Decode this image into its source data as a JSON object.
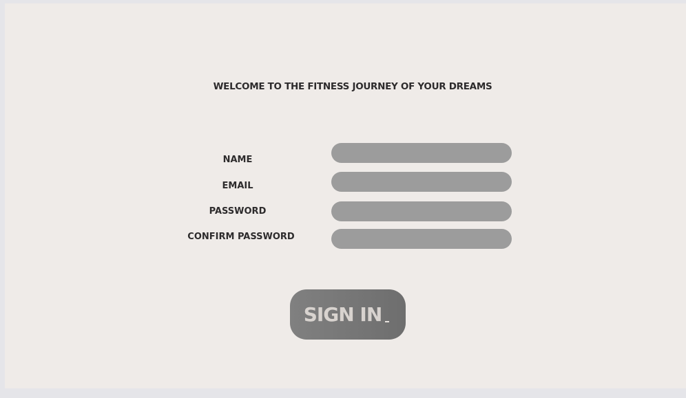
{
  "header": {
    "title": "WELCOME TO THE FITNESS JOURNEY OF YOUR DREAMS"
  },
  "form": {
    "fields": [
      {
        "label": "NAME",
        "value": "",
        "placeholder": ""
      },
      {
        "label": "EMAIL",
        "value": "",
        "placeholder": ""
      },
      {
        "label": "PASSWORD",
        "value": "",
        "placeholder": ""
      },
      {
        "label": "CONFIRM PASSWORD",
        "value": "",
        "placeholder": ""
      }
    ],
    "submit_label": "SIGN IN"
  },
  "colors": {
    "background": "#efebe8",
    "field": "#9c9c9c",
    "button": "#787878",
    "button_text": "#d8d3cf",
    "text": "#2d2b2c"
  }
}
